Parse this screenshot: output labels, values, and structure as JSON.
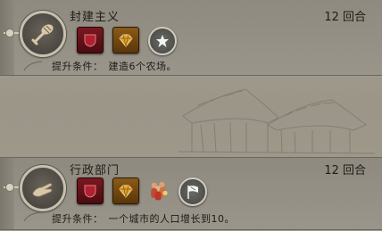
{
  "cards": [
    {
      "title": "封建主义",
      "turns": "12 回合",
      "requirement_label": "提升条件：",
      "requirement_text": "建造6个农场。",
      "medal_icon": "sword-and-bread-icon",
      "unlock_icons": [
        "red-gem-shield-icon",
        "gold-gem-shield-icon",
        "white-star-icon"
      ]
    },
    {
      "title": "行政部门",
      "turns": "12 回合",
      "requirement_label": "提升条件：",
      "requirement_text": "一个城市的人口增长到10。",
      "medal_icon": "open-hand-icon",
      "unlock_icons": [
        "red-gem-shield-icon",
        "gold-gem-shield-icon",
        "crowd-icon",
        "flag-icon"
      ]
    }
  ],
  "colors": {
    "background": "#9d978a",
    "medal_ring": "#c6bfae",
    "medal_icon": "#d8c8a8",
    "red_badge": "#7a1820",
    "gold_badge": "#8a5a18",
    "text": "#1e1c19"
  }
}
